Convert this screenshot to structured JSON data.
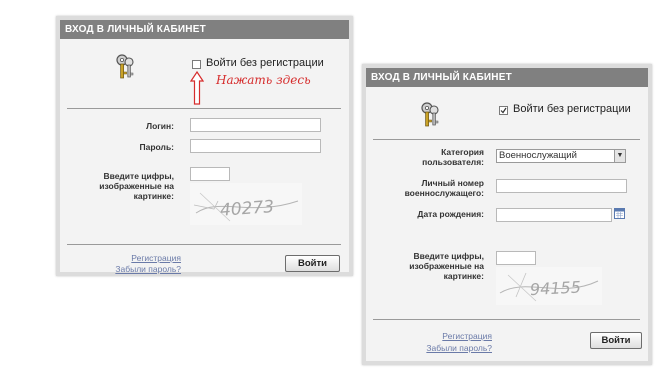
{
  "left_panel": {
    "title": "ВХОД В ЛИЧНЫЙ КАБИНЕТ",
    "no_reg_label": "Войти без регистрации",
    "hint": "Нажать здесь",
    "login_label": "Логин:",
    "password_label": "Пароль:",
    "captcha_label": "Введите цифры, изображенные на картинке:",
    "captcha_value": "40273",
    "register_link": "Регистрация",
    "forgot_link": "Забыли пароль?",
    "submit": "Войти"
  },
  "right_panel": {
    "title": "ВХОД В ЛИЧНЫЙ КАБИНЕТ",
    "no_reg_label": "Войти без регистрации",
    "category_label": "Категория пользователя:",
    "category_value": "Военнослужащий",
    "personal_number_label": "Личный номер военнослужащего:",
    "birth_date_label": "Дата рождения:",
    "captcha_label": "Введите цифры, изображенные на картинке:",
    "captcha_value": "94155",
    "register_link": "Регистрация",
    "forgot_link": "Забыли пароль?",
    "submit": "Войти"
  },
  "colors": {
    "header": "#808080",
    "hint": "#d62c2c",
    "link": "#6a7aa8"
  },
  "icons": [
    "keys-icon",
    "up-arrow-icon",
    "calendar-icon",
    "dropdown-arrow-icon",
    "checkmark-icon"
  ]
}
